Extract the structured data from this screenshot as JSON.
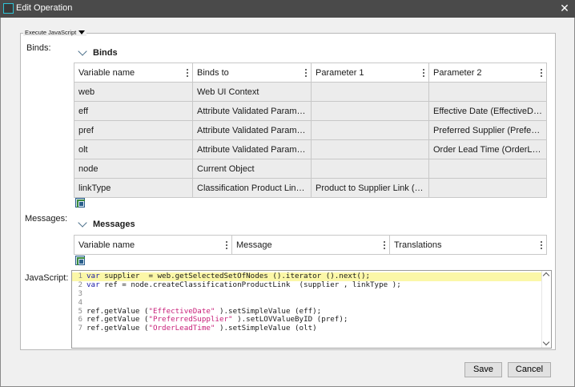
{
  "window": {
    "title": "Edit Operation",
    "close_glyph": "✕",
    "icon": "app-window-icon"
  },
  "group": {
    "title": "Execute JavaScript"
  },
  "binds": {
    "label": "Binds:",
    "section_title": "Binds",
    "columns": [
      "Variable name",
      "Binds to",
      "Parameter 1",
      "Parameter 2"
    ],
    "rows": [
      [
        "web",
        "Web UI Context",
        "",
        ""
      ],
      [
        "eff",
        "Attribute Validated Parameter",
        "",
        "Effective Date (EffectiveDate)"
      ],
      [
        "pref",
        "Attribute Validated Parameter",
        "",
        "Preferred Supplier (Preferred..."
      ],
      [
        "olt",
        "Attribute Validated Parameter",
        "",
        "Order Lead Time (OrderLead..."
      ],
      [
        "node",
        "Current Object",
        "",
        ""
      ],
      [
        "linkType",
        "Classification Product Link Ty...",
        "Product to Supplier Link (Pro...",
        ""
      ]
    ]
  },
  "messages": {
    "label": "Messages:",
    "section_title": "Messages",
    "columns": [
      "Variable name",
      "Message",
      "Translations"
    ]
  },
  "javascript": {
    "label": "JavaScript:",
    "lines": [
      {
        "num": "1",
        "highlight": true,
        "parts": [
          [
            "kw",
            "var "
          ],
          [
            "code",
            "supplier  = web.getSelectedSetOfNodes ().iterator ().next();"
          ]
        ]
      },
      {
        "num": "2",
        "highlight": false,
        "parts": [
          [
            "kw",
            "var "
          ],
          [
            "code",
            "ref = node.createClassificationProductLink  (supplier , linkType );"
          ]
        ]
      },
      {
        "num": "3",
        "highlight": false,
        "parts": []
      },
      {
        "num": "4",
        "highlight": false,
        "parts": []
      },
      {
        "num": "5",
        "highlight": false,
        "parts": [
          [
            "code",
            "ref.getValue ("
          ],
          [
            "str",
            "\"EffectiveDate\""
          ],
          [
            "code",
            " ).setSimpleValue (eff);"
          ]
        ]
      },
      {
        "num": "6",
        "highlight": false,
        "parts": [
          [
            "code",
            "ref.getValue ("
          ],
          [
            "str",
            "\"PreferredSupplier\""
          ],
          [
            "code",
            " ).setLOVValueByID (pref);"
          ]
        ]
      },
      {
        "num": "7",
        "highlight": false,
        "parts": [
          [
            "code",
            "ref.getValue ("
          ],
          [
            "str",
            "\"OrderLeadTime\""
          ],
          [
            "code",
            " ).setSimpleValue (olt)"
          ]
        ]
      }
    ]
  },
  "buttons": {
    "save": "Save",
    "cancel": "Cancel"
  }
}
